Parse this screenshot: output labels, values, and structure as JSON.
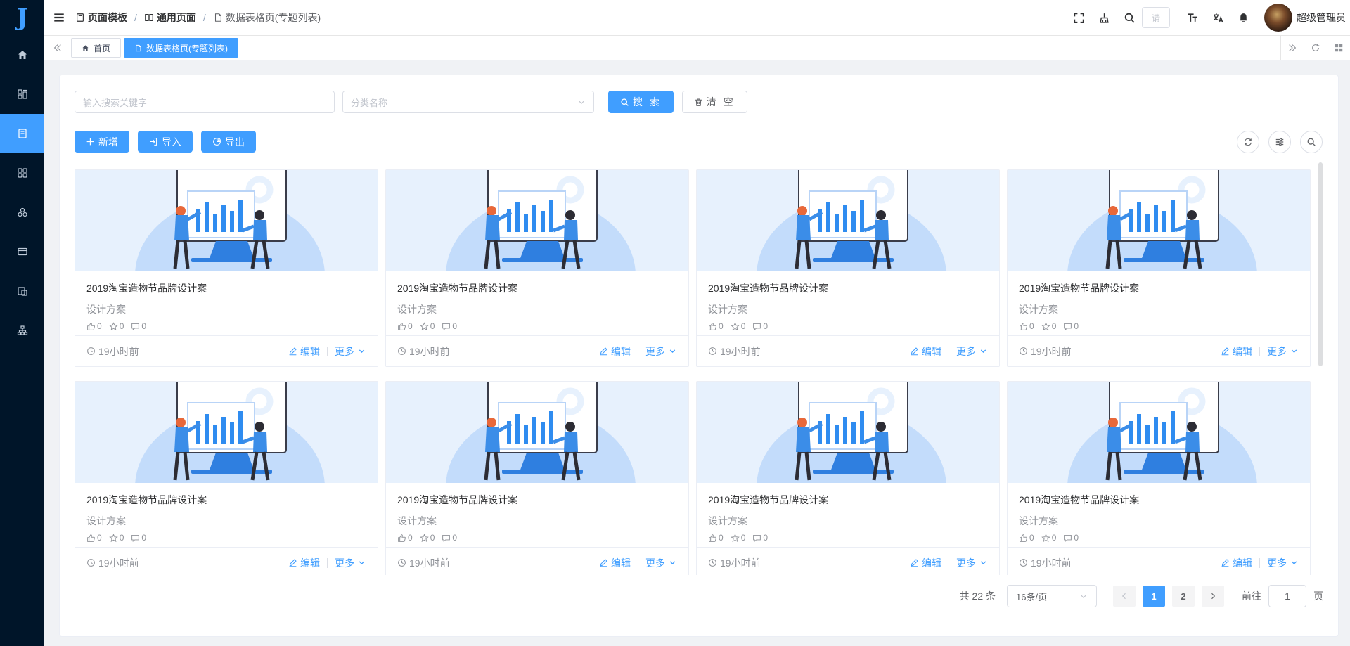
{
  "sidebar": {
    "logo": "J",
    "items": [
      {
        "icon": "home-icon",
        "active": false
      },
      {
        "icon": "component-icon",
        "active": false
      },
      {
        "icon": "template-icon",
        "active": true
      },
      {
        "icon": "grid-icon",
        "active": false
      },
      {
        "icon": "cluster-icon",
        "active": false
      },
      {
        "icon": "card-icon",
        "active": false
      },
      {
        "icon": "files-icon",
        "active": false
      },
      {
        "icon": "org-icon",
        "active": false
      }
    ]
  },
  "header": {
    "breadcrumb": [
      {
        "label": "页面模板",
        "icon": "template-icon"
      },
      {
        "label": "通用页面",
        "icon": "book-icon"
      },
      {
        "label": "数据表格页(专题列表)",
        "icon": "document-icon"
      }
    ],
    "search_placeholder": "请",
    "username": "超级管理员"
  },
  "tags": [
    {
      "label": "首页",
      "icon": "home-icon",
      "active": false
    },
    {
      "label": "数据表格页(专题列表)",
      "icon": "document-icon",
      "active": true
    }
  ],
  "search": {
    "keyword_placeholder": "输入搜索关键字",
    "category_placeholder": "分类名称",
    "search_label": "搜 索",
    "clear_label": "清 空"
  },
  "toolbar": {
    "add_label": "新增",
    "import_label": "导入",
    "export_label": "导出"
  },
  "cards": [
    {
      "title": "2019淘宝造物节品牌设计案",
      "category": "设计方案",
      "likes": "0",
      "stars": "0",
      "comments": "0",
      "time": "19小时前",
      "edit_label": "编辑",
      "more_label": "更多"
    },
    {
      "title": "2019淘宝造物节品牌设计案",
      "category": "设计方案",
      "likes": "0",
      "stars": "0",
      "comments": "0",
      "time": "19小时前",
      "edit_label": "编辑",
      "more_label": "更多"
    },
    {
      "title": "2019淘宝造物节品牌设计案",
      "category": "设计方案",
      "likes": "0",
      "stars": "0",
      "comments": "0",
      "time": "19小时前",
      "edit_label": "编辑",
      "more_label": "更多"
    },
    {
      "title": "2019淘宝造物节品牌设计案",
      "category": "设计方案",
      "likes": "0",
      "stars": "0",
      "comments": "0",
      "time": "19小时前",
      "edit_label": "编辑",
      "more_label": "更多"
    },
    {
      "title": "2019淘宝造物节品牌设计案",
      "category": "设计方案",
      "likes": "0",
      "stars": "0",
      "comments": "0",
      "time": "19小时前",
      "edit_label": "编辑",
      "more_label": "更多"
    },
    {
      "title": "2019淘宝造物节品牌设计案",
      "category": "设计方案",
      "likes": "0",
      "stars": "0",
      "comments": "0",
      "time": "19小时前",
      "edit_label": "编辑",
      "more_label": "更多"
    },
    {
      "title": "2019淘宝造物节品牌设计案",
      "category": "设计方案",
      "likes": "0",
      "stars": "0",
      "comments": "0",
      "time": "19小时前",
      "edit_label": "编辑",
      "more_label": "更多"
    },
    {
      "title": "2019淘宝造物节品牌设计案",
      "category": "设计方案",
      "likes": "0",
      "stars": "0",
      "comments": "0",
      "time": "19小时前",
      "edit_label": "编辑",
      "more_label": "更多"
    }
  ],
  "pagination": {
    "total_text": "共 22 条",
    "page_size": "16条/页",
    "pages": [
      "1",
      "2"
    ],
    "current": "1",
    "goto_prefix": "前往",
    "goto_value": "1",
    "goto_suffix": "页"
  },
  "colors": {
    "primary": "#409eff",
    "sidebar_bg": "#001529"
  }
}
